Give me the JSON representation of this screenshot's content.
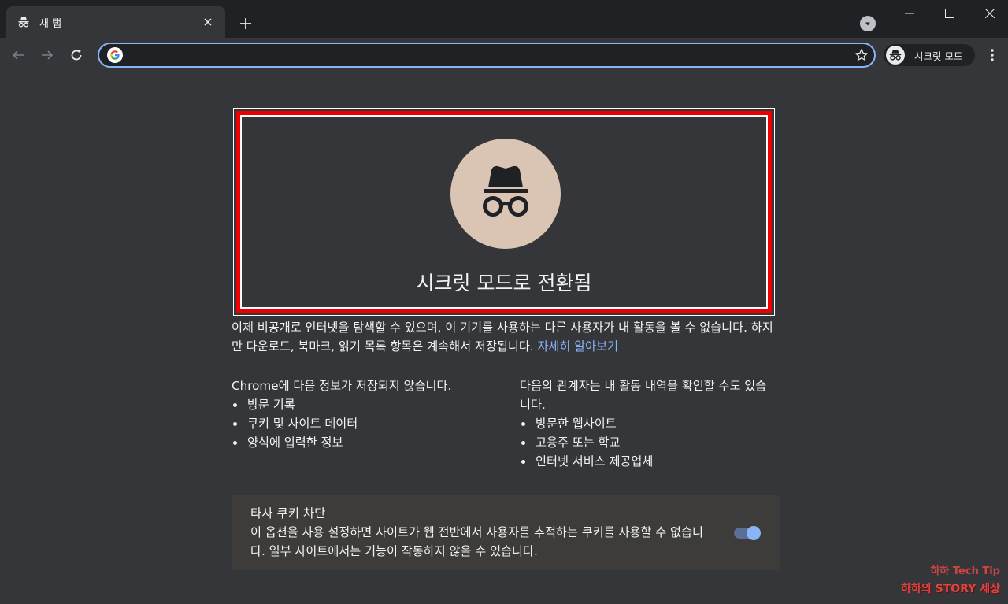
{
  "window": {
    "tab": {
      "title": "새 탭",
      "icon": "incognito-icon"
    },
    "new_tab_icon": "plus-icon",
    "controls": [
      "minimize-icon",
      "maximize-icon",
      "close-icon"
    ]
  },
  "toolbar": {
    "back_icon": "arrow-left-icon",
    "forward_icon": "arrow-right-icon",
    "reload_icon": "reload-icon",
    "omnibox": {
      "value": "",
      "placeholder": "",
      "icon": "google-icon"
    },
    "bookmark_icon": "star-icon",
    "profile_label": "시크릿 모드",
    "menu_icon": "kebab-menu-icon"
  },
  "page": {
    "hero_title": "시크릿 모드로 전환됨",
    "description": "이제 비공개로 인터넷을 탐색할 수 있으며, 이 기기를 사용하는 다른 사용자가 내 활동을 볼 수 없습니다. 하지만 다운로드, 북마크, 읽기 목록 항목은 계속해서 저장됩니다.",
    "learn_more": "자세히 알아보기",
    "not_saved": {
      "heading": "Chrome에 다음 정보가 저장되지 않습니다.",
      "items": [
        "방문 기록",
        "쿠키 및 사이트 데이터",
        "양식에 입력한 정보"
      ]
    },
    "visible_to": {
      "heading": "다음의 관계자는 내 활동 내역을 확인할 수도 있습니다.",
      "items": [
        "방문한 웹사이트",
        "고용주 또는 학교",
        "인터넷 서비스 제공업체"
      ]
    },
    "cookie_block": {
      "title": "타사 쿠키 차단",
      "description": "이 옵션을 사용 설정하면 사이트가 웹 전반에서 사용자를 추적하는 쿠키를 사용할 수 없습니다. 일부 사이트에서는 기능이 작동하지 않을 수 있습니다.",
      "enabled": true
    }
  },
  "watermark": {
    "line1": "하하 Tech Tip",
    "line2": "하하의 STORY 세상"
  },
  "colors": {
    "background": "#35363a",
    "tabstrip": "#202124",
    "accent": "#8ab4f8",
    "highlight_frame": "#ee0000",
    "incognito_circle": "#dac4b4"
  }
}
